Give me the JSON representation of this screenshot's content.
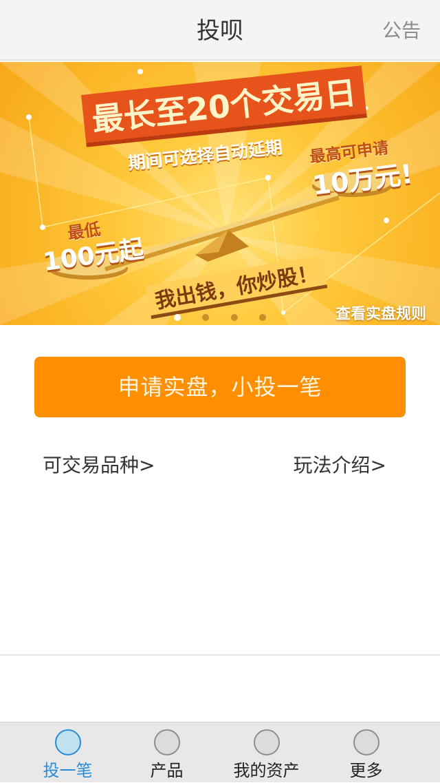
{
  "navbar": {
    "title": "投呗",
    "right_label": "公告"
  },
  "banner": {
    "headline": "最长至20个交易日",
    "subheadline": "期间可选择自动延期",
    "right_top": "最高可申请",
    "right_amount": "10万元!",
    "left_top": "最低",
    "left_amount": "100元起",
    "slogan": "我出钱，你炒股！",
    "rules_link": "查看实盘规则",
    "active_dot": 0,
    "dot_count": 4
  },
  "main": {
    "cta_label": "申请实盘，小投一笔",
    "left_link": "可交易品种>",
    "right_link": "玩法介绍>"
  },
  "tabbar": {
    "items": [
      {
        "label": "投一笔",
        "active": true,
        "icon": "circle-icon"
      },
      {
        "label": "产品",
        "active": false,
        "icon": "circle-icon"
      },
      {
        "label": "我的资产",
        "active": false,
        "icon": "circle-icon"
      },
      {
        "label": "更多",
        "active": false,
        "icon": "circle-icon"
      }
    ]
  },
  "colors": {
    "accent_orange": "#ff8f00",
    "tab_active_blue": "#2a8cd6"
  }
}
